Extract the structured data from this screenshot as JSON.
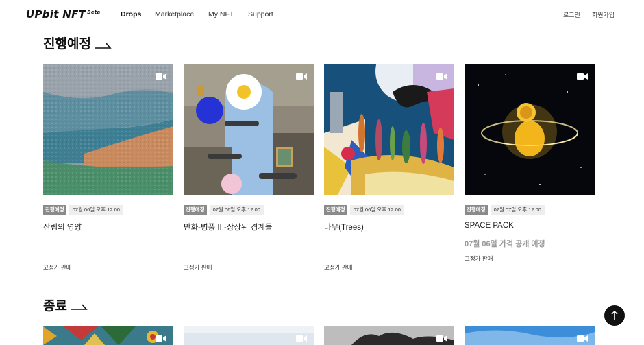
{
  "header": {
    "logo": "UPbit NFT",
    "logo_beta": "Beta",
    "nav": [
      "Drops",
      "Marketplace",
      "My NFT",
      "Support"
    ],
    "login": "로그인",
    "signup": "회원가입"
  },
  "sections": {
    "upcoming_title": "진행예정",
    "ended_title": "종료"
  },
  "upcoming": [
    {
      "status": "진행예정",
      "date": "07월 06일 오후 12:00",
      "title": "산림의 영양",
      "note": "",
      "sale": "고정가 판매"
    },
    {
      "status": "진행예정",
      "date": "07월 06일 오후 12:00",
      "title": "만화-병풍 II -상상된 경계들",
      "note": "",
      "sale": "고정가 판매"
    },
    {
      "status": "진행예정",
      "date": "07월 06일 오후 12:00",
      "title": "나무(Trees)",
      "note": "",
      "sale": "고정가 판매"
    },
    {
      "status": "진행예정",
      "date": "07월 07일 오후 12:00",
      "title": "SPACE PACK",
      "note": "07월 06일 가격 공개 예정",
      "sale": "고정가 판매"
    }
  ],
  "icons": {
    "video": "video-camera-icon",
    "scroll_top": "arrow-up-icon",
    "section_arrow": "arrow-right-icon"
  },
  "colors": {
    "badge_status": "#8a8a8a",
    "badge_date": "#eeeeee",
    "scroll_top": "#111111"
  }
}
